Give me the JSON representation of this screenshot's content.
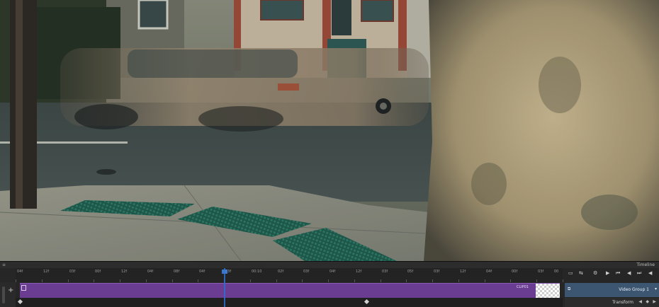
{
  "panel": {
    "title": "Timeline",
    "menu_glyph": "≡"
  },
  "ruler": {
    "ticks": [
      "04f",
      "12f",
      "03f",
      "00f",
      "12f",
      "04f",
      "08f",
      "04f",
      "03f",
      "00:10",
      "02f",
      "03f",
      "04f",
      "12f",
      "03f",
      "05f",
      "03f",
      "12f",
      "04f",
      "00f",
      "03f",
      "00"
    ]
  },
  "track": {
    "name": "Video Group 1",
    "clip_label": "CLIP01",
    "transform_label": "Transform"
  },
  "icons": {
    "add": "+",
    "dropdown": "▾",
    "toggle": "⇆",
    "gear": "⚙",
    "play": "▶",
    "prev": "⏮",
    "back": "◀",
    "next": "⏭",
    "fwd": "▶",
    "audio": "◀",
    "film": "▭",
    "link": "⧉",
    "kf_prev": "◀",
    "kf_add": "◆",
    "kf_next": "▶"
  },
  "colors": {
    "clip": "#6a3d93",
    "track_header": "#3c5570",
    "playhead": "#2b6fd1"
  }
}
